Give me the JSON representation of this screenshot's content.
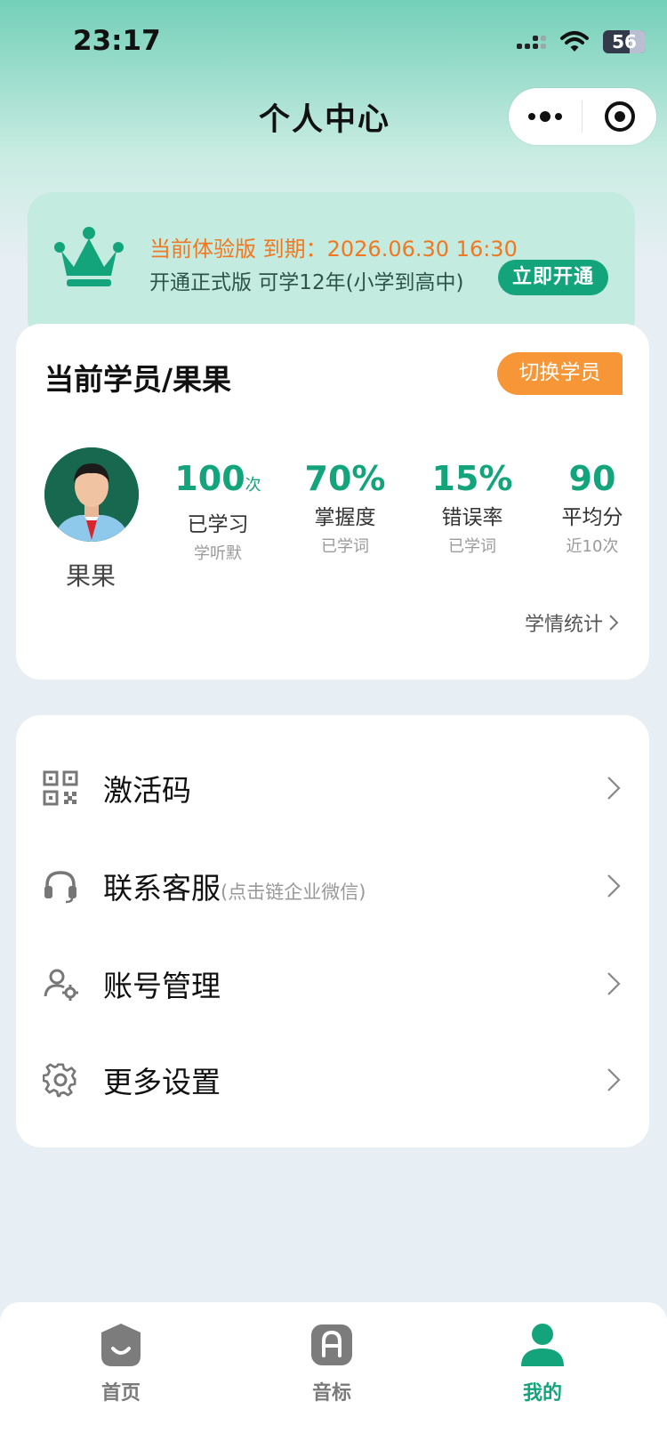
{
  "status_bar": {
    "time": "23:17",
    "battery": "56"
  },
  "header": {
    "title": "个人中心"
  },
  "vip_banner": {
    "line1": "当前体验版 到期：2026.06.30 16:30",
    "line2": "开通正式版 可学12年(小学到高中)",
    "button": "立即开通",
    "accent_color": "#13a47c",
    "warning_color": "#f07822"
  },
  "student": {
    "title": "当前学员/果果",
    "switch_button": "切换学员",
    "avatar_name": "果果",
    "stats": [
      {
        "value": "100",
        "unit": "次",
        "label": "已学习",
        "sub": "学听默"
      },
      {
        "value": "70%",
        "unit": "",
        "label": "掌握度",
        "sub": "已学词"
      },
      {
        "value": "15%",
        "unit": "",
        "label": "错误率",
        "sub": "已学词"
      },
      {
        "value": "90",
        "unit": "",
        "label": "平均分",
        "sub": "近10次"
      }
    ],
    "report_link": "学情统计"
  },
  "menu": {
    "items": [
      {
        "label": "激活码",
        "hint": "",
        "icon": "qrcode-icon"
      },
      {
        "label": "联系客服",
        "hint": "(点击链企业微信)",
        "icon": "headset-icon"
      },
      {
        "label": "账号管理",
        "hint": "",
        "icon": "user-gear-icon"
      },
      {
        "label": "更多设置",
        "hint": "",
        "icon": "gear-icon"
      }
    ]
  },
  "tabbar": {
    "tabs": [
      {
        "label": "首页",
        "icon": "home-icon",
        "active": false
      },
      {
        "label": "音标",
        "icon": "phonetic-icon",
        "active": false
      },
      {
        "label": "我的",
        "icon": "profile-icon",
        "active": true
      }
    ]
  }
}
